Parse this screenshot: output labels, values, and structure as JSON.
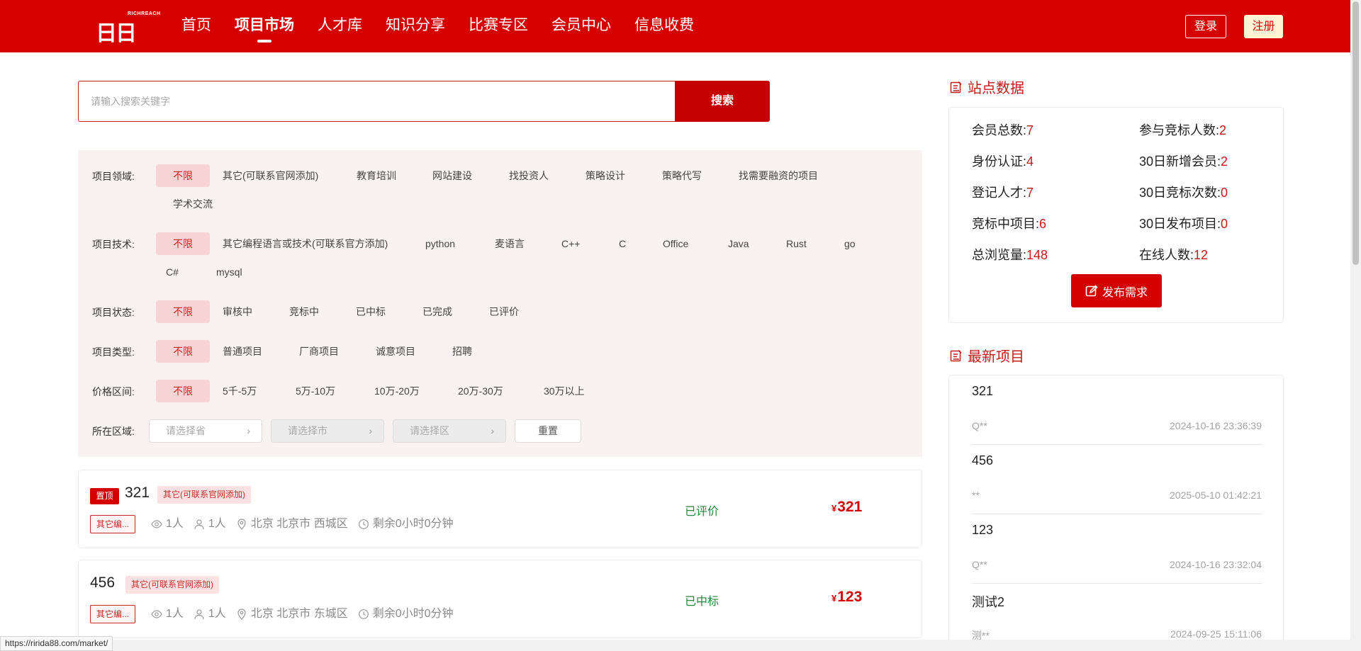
{
  "header": {
    "logo_text": "日日达",
    "logo_sub": "RICHREACH",
    "nav": [
      {
        "label": "首页",
        "active": false
      },
      {
        "label": "项目市场",
        "active": true
      },
      {
        "label": "人才库",
        "active": false
      },
      {
        "label": "知识分享",
        "active": false
      },
      {
        "label": "比赛专区",
        "active": false
      },
      {
        "label": "会员中心",
        "active": false
      },
      {
        "label": "信息收费",
        "active": false
      }
    ],
    "login_label": "登录",
    "register_label": "注册"
  },
  "search": {
    "placeholder": "请输入搜索关键字",
    "button_label": "搜索"
  },
  "filters": {
    "domain": {
      "label": "项目领域:",
      "options": [
        "不限",
        "其它(可联系官网添加)",
        "教育培训",
        "网站建设",
        "找投资人",
        "策略设计",
        "策略代写",
        "找需要融资的项目",
        "学术交流"
      ]
    },
    "tech": {
      "label": "项目技术:",
      "options": [
        "不限",
        "其它编程语言或技术(可联系官方添加)",
        "python",
        "麦语言",
        "C++",
        "C",
        "Office",
        "Java",
        "Rust",
        "go",
        "C#",
        "mysql"
      ]
    },
    "status": {
      "label": "项目状态:",
      "options": [
        "不限",
        "审核中",
        "竞标中",
        "已中标",
        "已完成",
        "已评价"
      ]
    },
    "type": {
      "label": "项目类型:",
      "options": [
        "不限",
        "普通项目",
        "厂商项目",
        "诚意项目",
        "招聘"
      ]
    },
    "price": {
      "label": "价格区间:",
      "options": [
        "不限",
        "5千-5万",
        "5万-10万",
        "10万-20万",
        "20万-30万",
        "30万以上"
      ]
    },
    "region": {
      "label": "所在区域:",
      "province_placeholder": "请选择省",
      "city_placeholder": "请选择市",
      "district_placeholder": "请选择区",
      "reset_label": "重置"
    }
  },
  "projects": [
    {
      "pinned": true,
      "pin_label": "置顶",
      "title": "321",
      "category": "其它(可联系官网添加)",
      "tech": "其它编...",
      "views": "1人",
      "bidders": "1人",
      "location": "北京 北京市 西城区",
      "remaining": "剩余0小时0分钟",
      "status": "已评价",
      "currency": "¥",
      "price": "321"
    },
    {
      "pinned": false,
      "pin_label": "",
      "title": "456",
      "category": "其它(可联系官网添加)",
      "tech": "其它编...",
      "views": "1人",
      "bidders": "1人",
      "location": "北京 北京市 东城区",
      "remaining": "剩余0小时0分钟",
      "status": "已中标",
      "currency": "¥",
      "price": "123"
    }
  ],
  "site_stats": {
    "title": "站点数据",
    "items": [
      {
        "label": "会员总数:",
        "value": "7"
      },
      {
        "label": "参与竞标人数:",
        "value": "2"
      },
      {
        "label": "身份认证:",
        "value": "4"
      },
      {
        "label": "30日新增会员:",
        "value": "2"
      },
      {
        "label": "登记人才:",
        "value": "7"
      },
      {
        "label": "30日竞标次数:",
        "value": "0"
      },
      {
        "label": "竞标中项目:",
        "value": "6"
      },
      {
        "label": "30日发布项目:",
        "value": "0"
      },
      {
        "label": "总浏览量:",
        "value": "148"
      },
      {
        "label": "在线人数:",
        "value": "12"
      }
    ],
    "publish_label": "发布需求"
  },
  "latest": {
    "title": "最新项目",
    "items": [
      {
        "title": "321",
        "user": "Q**",
        "date": "2024-10-16 23:36:39"
      },
      {
        "title": "456",
        "user": "**",
        "date": "2025-05-10 01:42:21"
      },
      {
        "title": "123",
        "user": "Q**",
        "date": "2024-10-16 23:32:04"
      },
      {
        "title": "测试2",
        "user": "测**",
        "date": "2024-09-25 15:11:06"
      }
    ]
  },
  "status_bar": {
    "url": "https://ririda88.com/market/"
  },
  "colors": {
    "brand": "#d50000",
    "status_green": "#23863a",
    "price_red": "#d40000"
  }
}
